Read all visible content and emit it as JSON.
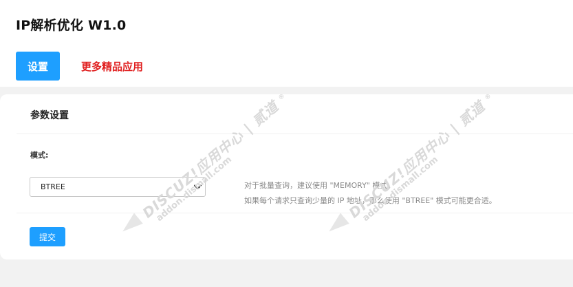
{
  "header": {
    "title": "IP解析优化 W1.0",
    "tabs": [
      {
        "label": "设置"
      }
    ],
    "more_apps_label": "更多精品应用"
  },
  "panel": {
    "title": "参数设置",
    "mode_label": "模式:",
    "mode_select": {
      "selected": "BTREE"
    },
    "help_lines": [
      "对于批量查询，建议使用 \"MEMORY\" 模式。",
      "如果每个请求只查询少量的 IP 地址，那么使用 \"BTREE\" 模式可能更合适。"
    ],
    "submit_label": "提交"
  },
  "watermark": {
    "brand": "DISCUZ!应用中心",
    "separator": "|",
    "partner": "贰道",
    "domain": "addon.dismall.com",
    "registered": "®"
  },
  "colors": {
    "accent": "#1e9fff",
    "link_red": "#e02020",
    "page_bg": "#f2f2f2"
  },
  "icons": {
    "select_chevron": "chevron-down-icon"
  }
}
